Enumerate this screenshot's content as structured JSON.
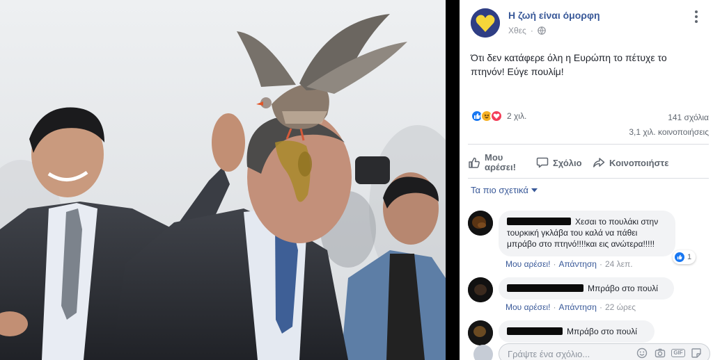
{
  "post": {
    "page_name": "Η ζωή είναι όμορφη",
    "time": "Χθες",
    "text": "Ότι δεν κατάφερε όλη η Ευρώπη το πέτυχε το πτηνόν! Εύγε πουλίμ!",
    "reactions_count": "2 χιλ.",
    "comments_count": "141 σχόλια",
    "shares_count": "3,1 χιλ. κοινοποιήσεις"
  },
  "actions": {
    "like_label_1": "Μου",
    "like_label_2": "αρέσει!",
    "comment_label": "Σχόλιο",
    "share_label": "Κοινοποιήστε"
  },
  "sort": {
    "label": "Τα πιο σχετικά"
  },
  "comments": [
    {
      "text": "Χεσαι το πουλάκι στην τουρκική γκλάβα του καλά να πάθει μπράβο στο πτηνό!!!!και εις ανώτερα!!!!!",
      "like": "Μου αρέσει!",
      "reply": "Απάντηση",
      "time": "24 λεπ.",
      "likes": "1"
    },
    {
      "text": "Μπράβο στο πουλί",
      "like": "Μου αρέσει!",
      "reply": "Απάντηση",
      "time": "22 ώρες"
    },
    {
      "text": "Μπράβο στο πουλί"
    }
  ],
  "composer": {
    "placeholder": "Γράψτε ένα σχόλιο..."
  },
  "icons": [
    "globe-icon",
    "more-options-icon",
    "like-icon",
    "haha-icon",
    "love-icon",
    "comment-icon",
    "share-icon",
    "chevron-down-icon",
    "emoji-icon",
    "camera-icon",
    "gif-icon",
    "sticker-icon"
  ],
  "colors": {
    "link": "#385898",
    "like_blue": "#1877f2",
    "love_red": "#f33e58",
    "haha_yellow": "#f7b125",
    "panel_bg": "#ffffff",
    "bubble": "#f2f3f5"
  }
}
